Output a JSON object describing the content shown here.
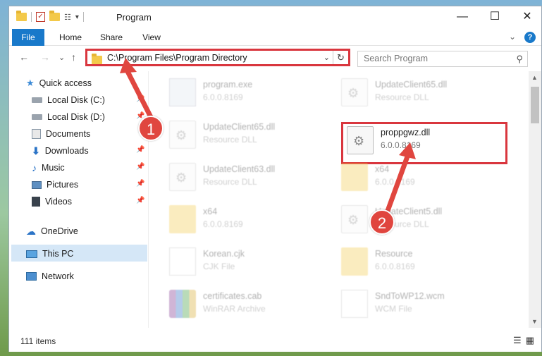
{
  "window": {
    "title": "Program",
    "qat_dropdown": "▾"
  },
  "window_controls": {
    "minimize": "—",
    "maximize": "☐",
    "close": "✕"
  },
  "ribbon": {
    "tabs": [
      {
        "label": "File"
      },
      {
        "label": "Home"
      },
      {
        "label": "Share"
      },
      {
        "label": "View"
      }
    ],
    "expand": "⌄",
    "help": "?"
  },
  "nav": {
    "back": "←",
    "forward": "→",
    "recent": "⌄",
    "up": "↑"
  },
  "address": {
    "path": "C:\\Program Files\\Program Directory",
    "dropdown": "⌄",
    "refresh": "↻"
  },
  "search": {
    "placeholder": "Search Program",
    "icon": "⚲"
  },
  "sidebar": {
    "items": [
      {
        "label": "Quick access",
        "icon": "star-icon"
      },
      {
        "label": "Local Disk (C:)",
        "icon": "drive-icon"
      },
      {
        "label": "Local Disk (D:)",
        "icon": "drive-icon"
      },
      {
        "label": "Documents",
        "icon": "documents-icon"
      },
      {
        "label": "Downloads",
        "icon": "download-icon"
      },
      {
        "label": "Music",
        "icon": "music-icon"
      },
      {
        "label": "Pictures",
        "icon": "pictures-icon"
      },
      {
        "label": "Videos",
        "icon": "videos-icon"
      },
      {
        "label": "OneDrive",
        "icon": "cloud-icon"
      },
      {
        "label": "This PC",
        "icon": "computer-icon"
      },
      {
        "label": "Network",
        "icon": "network-icon"
      }
    ],
    "pin_glyph": "📌"
  },
  "files": [
    {
      "name": "program.exe",
      "sub": "6.0.0.8169",
      "type": "exe"
    },
    {
      "name": "UpdateClient65.dll",
      "sub": "Resource DLL",
      "type": "dll"
    },
    {
      "name": "UpdateClient65.dll",
      "sub": "Resource DLL",
      "type": "dll"
    },
    {
      "name": "proppgwz.dll",
      "sub": "6.0.0.8169",
      "type": "dll"
    },
    {
      "name": "UpdateClient63.dll",
      "sub": "Resource DLL",
      "type": "dll"
    },
    {
      "name": "x64",
      "sub": "6.0.0.8169",
      "type": "folder"
    },
    {
      "name": "x64",
      "sub": "6.0.0.8169",
      "type": "folder"
    },
    {
      "name": "UpdateClient5.dll",
      "sub": "Resource DLL",
      "type": "dll"
    },
    {
      "name": "Korean.cjk",
      "sub": "CJK File",
      "type": "text"
    },
    {
      "name": "Resource",
      "sub": "6.0.0.8169",
      "type": "folder"
    },
    {
      "name": "certificates.cab",
      "sub": "WinRAR Archive",
      "type": "cab"
    },
    {
      "name": "SndToWP12.wcm",
      "sub": "WCM File",
      "type": "text"
    }
  ],
  "status": {
    "count": "111 items",
    "details_view": "☰",
    "tiles_view": "▦"
  },
  "callouts": [
    {
      "label": "1"
    },
    {
      "label": "2"
    }
  ],
  "colors": {
    "accent": "#1979ca",
    "highlight": "#d9363e",
    "callout": "#e0463f"
  }
}
